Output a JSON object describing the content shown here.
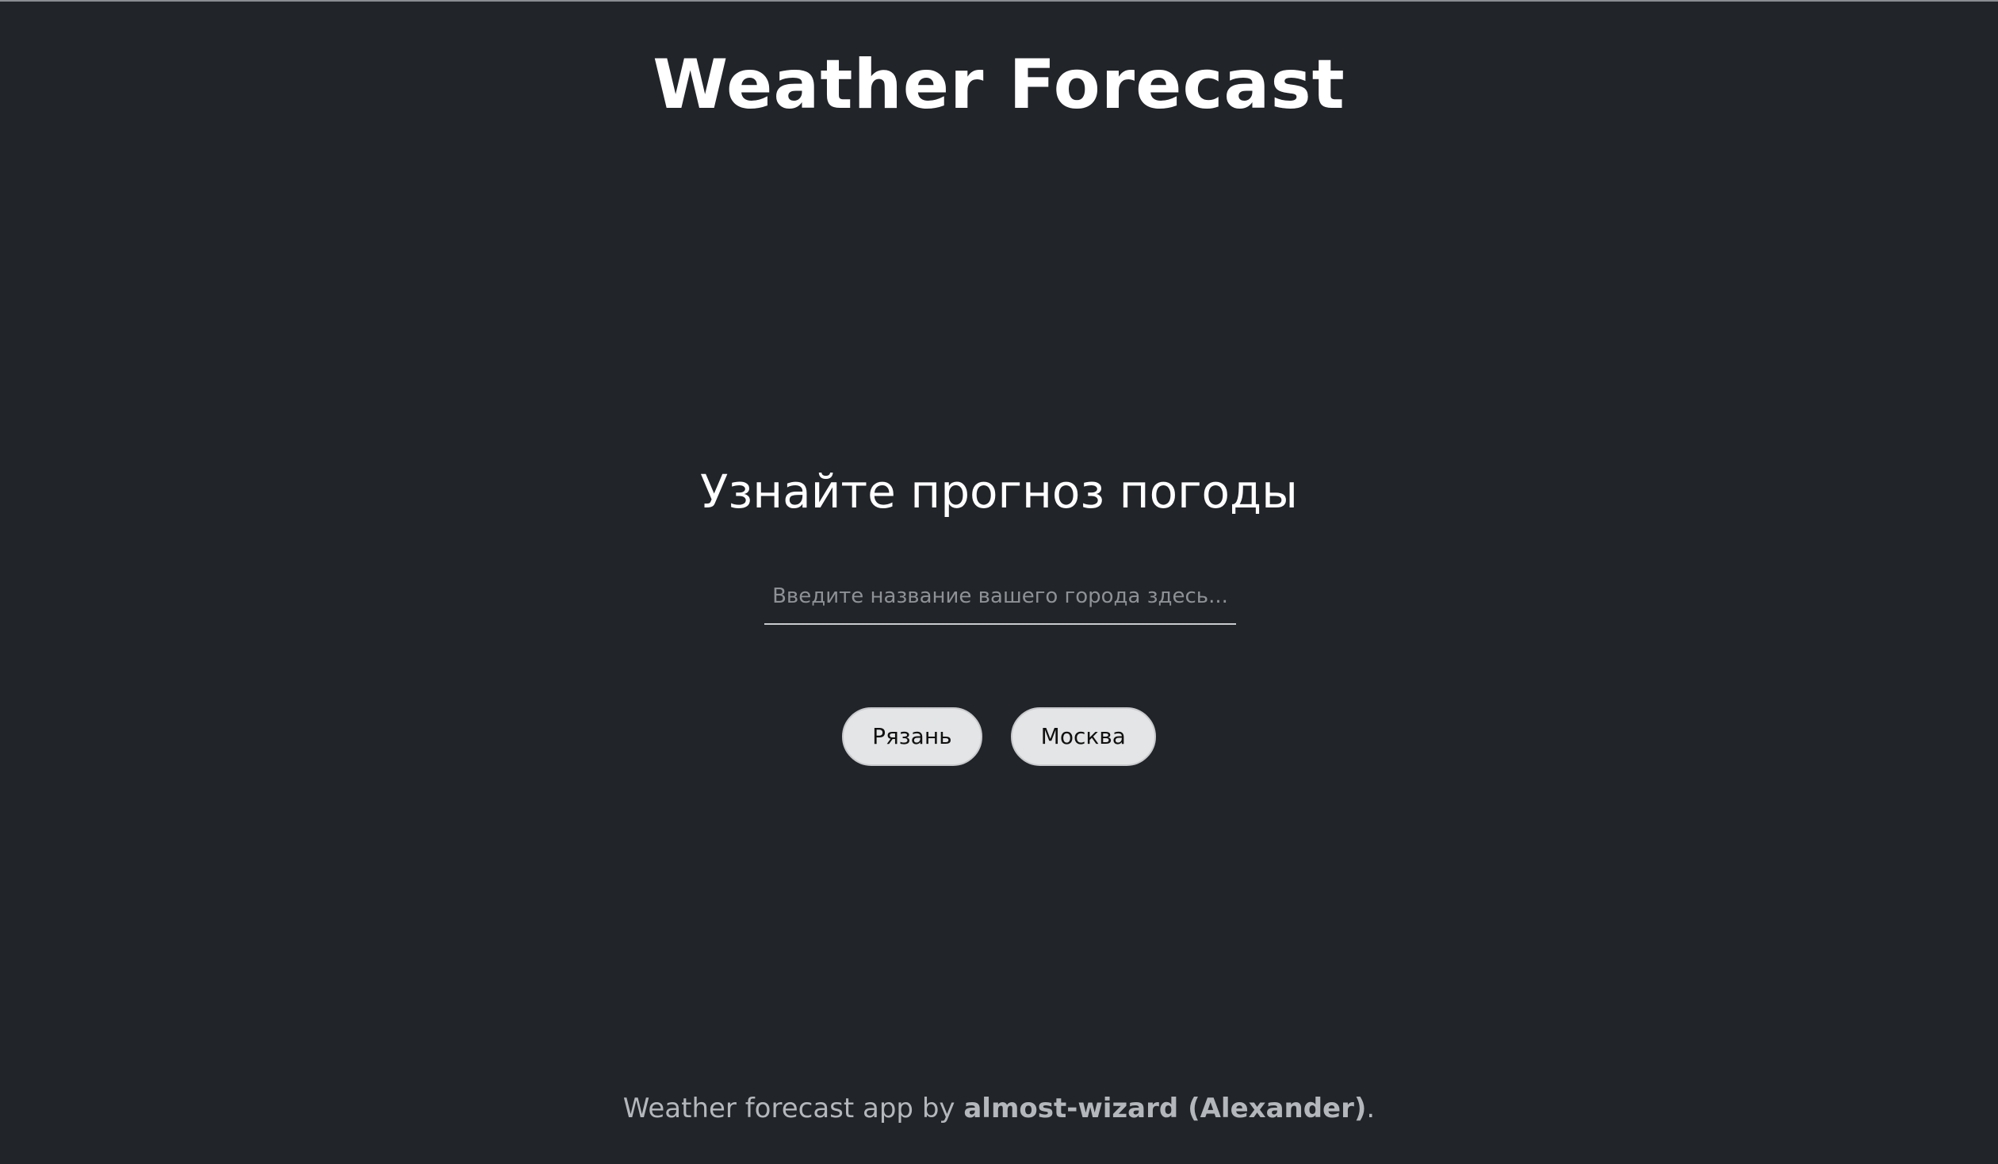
{
  "header": {
    "title": "Weather Forecast"
  },
  "main": {
    "heading": "Узнайте прогноз погоды",
    "search": {
      "placeholder": "Введите название вашего города здесь...",
      "value": ""
    },
    "cities": [
      {
        "label": "Рязань"
      },
      {
        "label": "Москва"
      }
    ]
  },
  "footer": {
    "prefix": "Weather forecast app by ",
    "author": "almost-wizard (Alexander)",
    "suffix": "."
  },
  "colors": {
    "background": "#212429",
    "text": "#ffffff",
    "button_bg": "#e4e5e6",
    "footer_text": "#b4b7bb"
  }
}
